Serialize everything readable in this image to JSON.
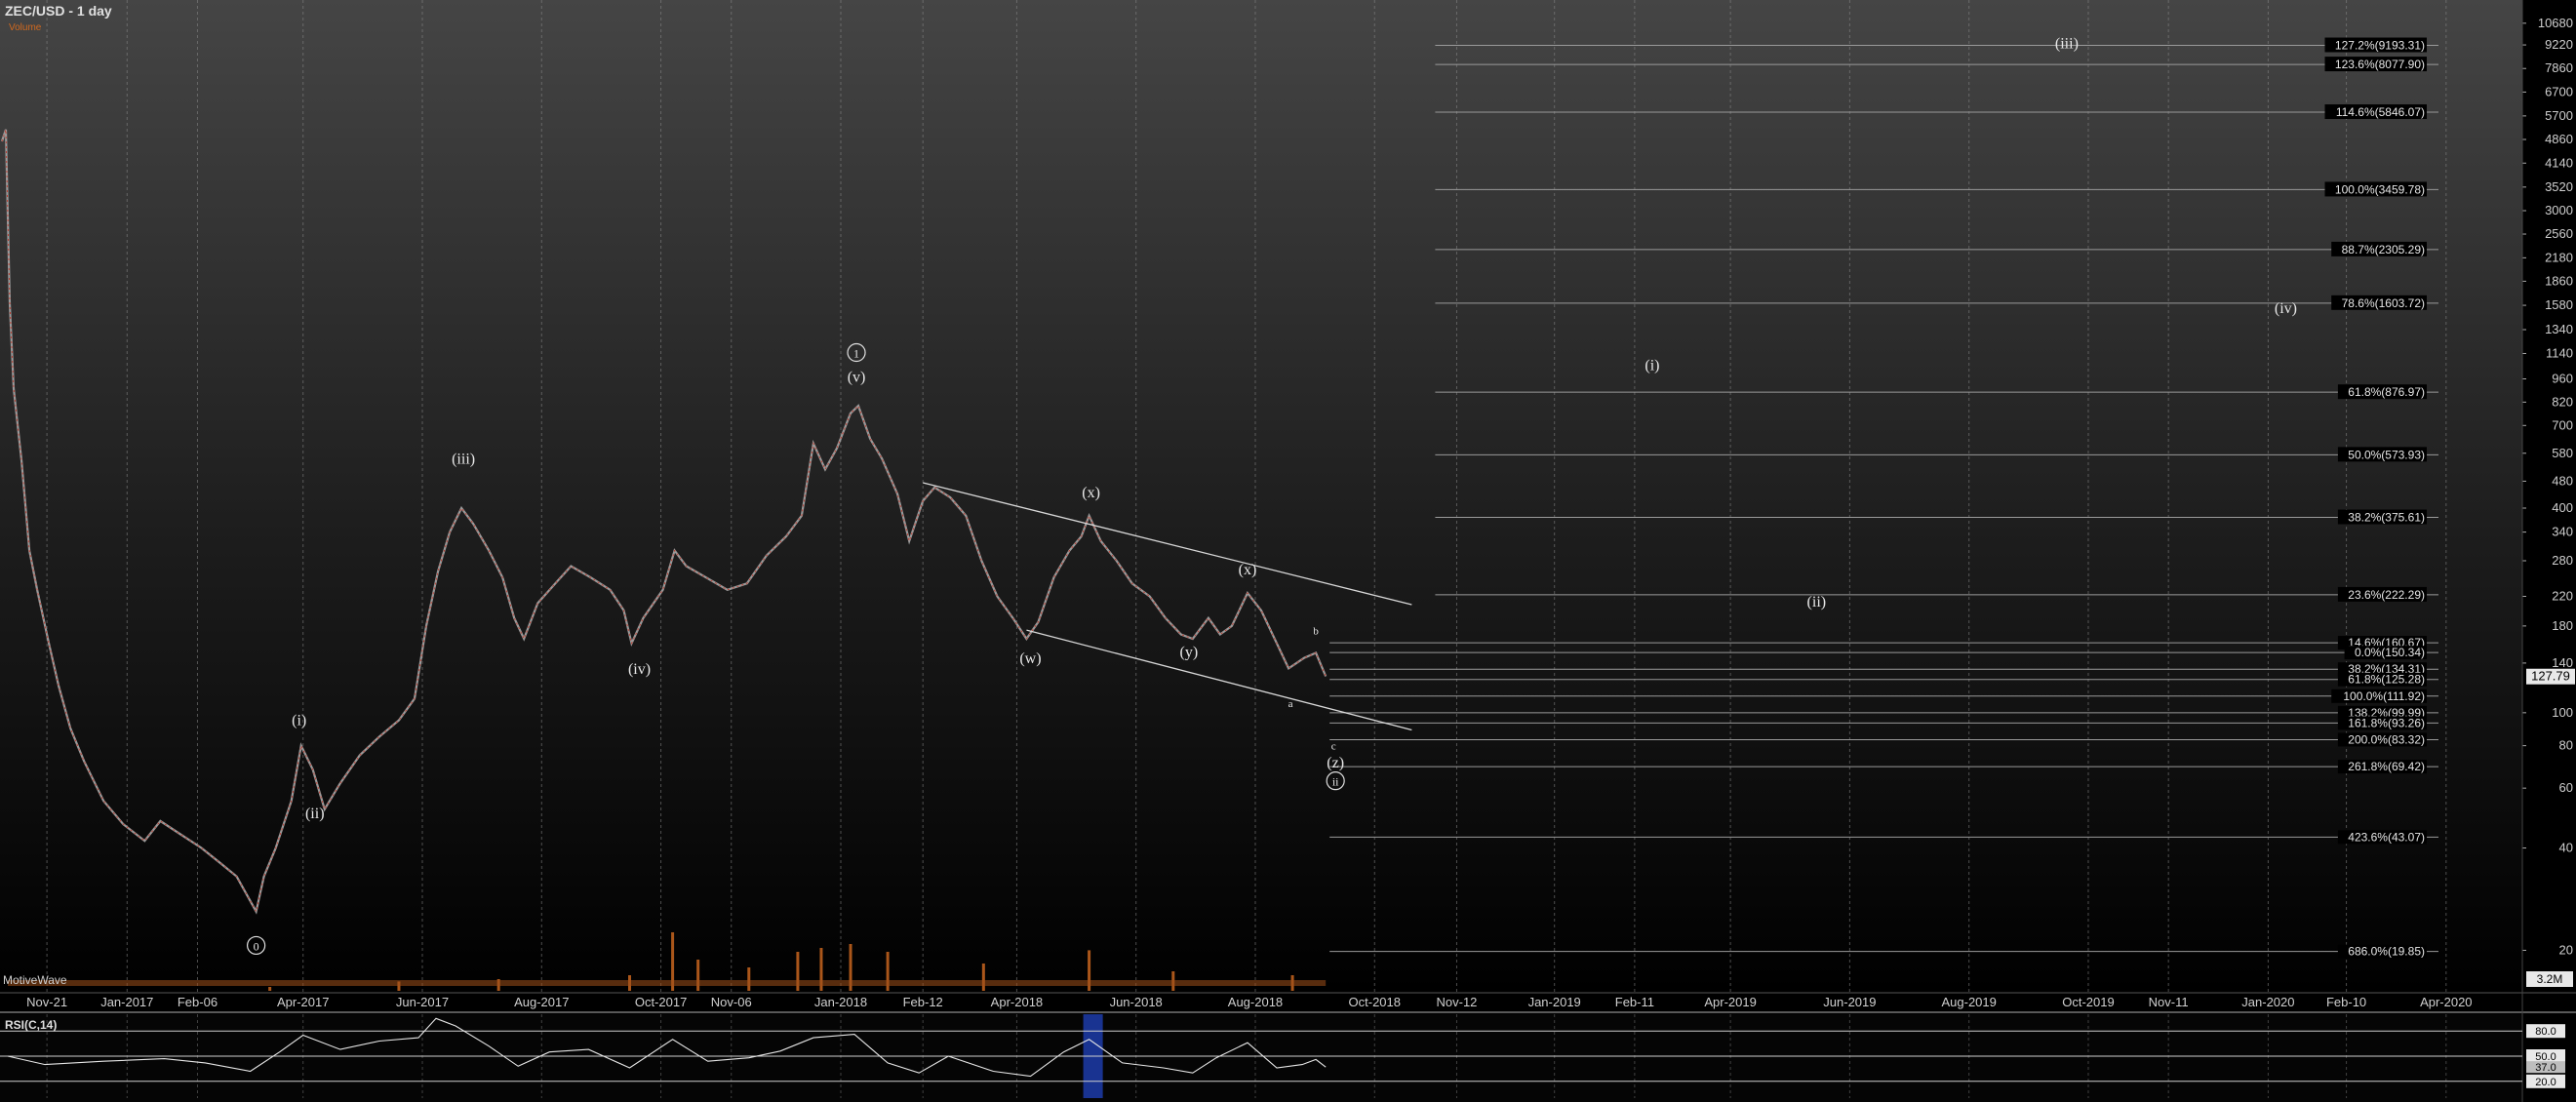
{
  "chart_data": {
    "type": "line",
    "title": "ZEC/USD - 1 day",
    "volume_label": "Volume",
    "motive_label": "MotiveWave",
    "price_axis": {
      "scale": "log",
      "range": [
        15,
        12500
      ],
      "ticks": [
        10680,
        9220,
        7860,
        6700,
        5700,
        4860,
        4140,
        3520,
        3000,
        2560,
        2180,
        1860,
        1580,
        1340,
        1140,
        960,
        820,
        700,
        580,
        480,
        400,
        340,
        280,
        220,
        180,
        140,
        100,
        80,
        60,
        40,
        20
      ]
    },
    "date_axis": {
      "range": [
        "2016-10-28",
        "2020-05-10"
      ],
      "ticks": [
        {
          "date": "2016-11-21",
          "label": "Nov-21"
        },
        {
          "date": "2017-01-01",
          "label": "Jan-2017"
        },
        {
          "date": "2017-02-06",
          "label": "Feb-06"
        },
        {
          "date": "2017-04-01",
          "label": "Apr-2017"
        },
        {
          "date": "2017-06-01",
          "label": "Jun-2017"
        },
        {
          "date": "2017-08-01",
          "label": "Aug-2017"
        },
        {
          "date": "2017-10-01",
          "label": "Oct-2017"
        },
        {
          "date": "2017-11-06",
          "label": "Nov-06"
        },
        {
          "date": "2018-01-01",
          "label": "Jan-2018"
        },
        {
          "date": "2018-02-12",
          "label": "Feb-12"
        },
        {
          "date": "2018-04-01",
          "label": "Apr-2018"
        },
        {
          "date": "2018-06-01",
          "label": "Jun-2018"
        },
        {
          "date": "2018-08-01",
          "label": "Aug-2018"
        },
        {
          "date": "2018-10-01",
          "label": "Oct-2018"
        },
        {
          "date": "2018-11-12",
          "label": "Nov-12"
        },
        {
          "date": "2019-01-01",
          "label": "Jan-2019"
        },
        {
          "date": "2019-02-11",
          "label": "Feb-11"
        },
        {
          "date": "2019-04-01",
          "label": "Apr-2019"
        },
        {
          "date": "2019-06-01",
          "label": "Jun-2019"
        },
        {
          "date": "2019-08-01",
          "label": "Aug-2019"
        },
        {
          "date": "2019-10-01",
          "label": "Oct-2019"
        },
        {
          "date": "2019-11-11",
          "label": "Nov-11"
        },
        {
          "date": "2020-01-01",
          "label": "Jan-2020"
        },
        {
          "date": "2020-02-10",
          "label": "Feb-10"
        },
        {
          "date": "2020-04-01",
          "label": "Apr-2020"
        }
      ]
    },
    "price_series": [
      [
        "2016-10-29",
        4800
      ],
      [
        "2016-10-31",
        5200
      ],
      [
        "2016-11-02",
        1600
      ],
      [
        "2016-11-04",
        900
      ],
      [
        "2016-11-08",
        550
      ],
      [
        "2016-11-12",
        300
      ],
      [
        "2016-11-16",
        230
      ],
      [
        "2016-11-22",
        160
      ],
      [
        "2016-11-27",
        120
      ],
      [
        "2016-12-03",
        90
      ],
      [
        "2016-12-10",
        72
      ],
      [
        "2016-12-20",
        55
      ],
      [
        "2016-12-30",
        47
      ],
      [
        "2017-01-10",
        42
      ],
      [
        "2017-01-18",
        48
      ],
      [
        "2017-01-28",
        44
      ],
      [
        "2017-02-08",
        40
      ],
      [
        "2017-02-18",
        36
      ],
      [
        "2017-02-26",
        33
      ],
      [
        "2017-03-02",
        30
      ],
      [
        "2017-03-08",
        26
      ],
      [
        "2017-03-12",
        33
      ],
      [
        "2017-03-18",
        40
      ],
      [
        "2017-03-26",
        55
      ],
      [
        "2017-03-31",
        80
      ],
      [
        "2017-04-06",
        68
      ],
      [
        "2017-04-12",
        52
      ],
      [
        "2017-04-20",
        62
      ],
      [
        "2017-04-30",
        75
      ],
      [
        "2017-05-10",
        85
      ],
      [
        "2017-05-20",
        95
      ],
      [
        "2017-05-28",
        110
      ],
      [
        "2017-06-03",
        180
      ],
      [
        "2017-06-09",
        260
      ],
      [
        "2017-06-15",
        340
      ],
      [
        "2017-06-21",
        400
      ],
      [
        "2017-06-27",
        360
      ],
      [
        "2017-07-05",
        300
      ],
      [
        "2017-07-12",
        250
      ],
      [
        "2017-07-18",
        190
      ],
      [
        "2017-07-23",
        165
      ],
      [
        "2017-07-30",
        210
      ],
      [
        "2017-08-08",
        240
      ],
      [
        "2017-08-16",
        270
      ],
      [
        "2017-08-26",
        250
      ],
      [
        "2017-09-05",
        230
      ],
      [
        "2017-09-12",
        200
      ],
      [
        "2017-09-16",
        160
      ],
      [
        "2017-09-22",
        190
      ],
      [
        "2017-10-02",
        230
      ],
      [
        "2017-10-08",
        300
      ],
      [
        "2017-10-14",
        270
      ],
      [
        "2017-10-24",
        250
      ],
      [
        "2017-11-04",
        230
      ],
      [
        "2017-11-14",
        240
      ],
      [
        "2017-11-24",
        290
      ],
      [
        "2017-12-04",
        330
      ],
      [
        "2017-12-12",
        380
      ],
      [
        "2017-12-18",
        620
      ],
      [
        "2017-12-24",
        520
      ],
      [
        "2017-12-30",
        600
      ],
      [
        "2018-01-06",
        760
      ],
      [
        "2018-01-10",
        800
      ],
      [
        "2018-01-16",
        640
      ],
      [
        "2018-01-22",
        560
      ],
      [
        "2018-01-30",
        440
      ],
      [
        "2018-02-05",
        320
      ],
      [
        "2018-02-12",
        420
      ],
      [
        "2018-02-18",
        460
      ],
      [
        "2018-02-26",
        430
      ],
      [
        "2018-03-06",
        380
      ],
      [
        "2018-03-14",
        280
      ],
      [
        "2018-03-22",
        220
      ],
      [
        "2018-03-30",
        190
      ],
      [
        "2018-04-06",
        165
      ],
      [
        "2018-04-12",
        185
      ],
      [
        "2018-04-20",
        250
      ],
      [
        "2018-04-28",
        300
      ],
      [
        "2018-05-04",
        330
      ],
      [
        "2018-05-08",
        380
      ],
      [
        "2018-05-14",
        320
      ],
      [
        "2018-05-22",
        280
      ],
      [
        "2018-05-30",
        240
      ],
      [
        "2018-06-08",
        220
      ],
      [
        "2018-06-16",
        190
      ],
      [
        "2018-06-24",
        170
      ],
      [
        "2018-06-30",
        165
      ],
      [
        "2018-07-08",
        190
      ],
      [
        "2018-07-14",
        170
      ],
      [
        "2018-07-20",
        180
      ],
      [
        "2018-07-28",
        225
      ],
      [
        "2018-08-04",
        200
      ],
      [
        "2018-08-12",
        160
      ],
      [
        "2018-08-18",
        135
      ],
      [
        "2018-08-26",
        145
      ],
      [
        "2018-09-01",
        150
      ],
      [
        "2018-09-06",
        128
      ]
    ],
    "volume_series": [
      [
        "2017-03-15",
        0.05
      ],
      [
        "2017-05-20",
        0.12
      ],
      [
        "2017-07-10",
        0.15
      ],
      [
        "2017-09-15",
        0.2
      ],
      [
        "2017-10-07",
        0.75
      ],
      [
        "2017-10-20",
        0.4
      ],
      [
        "2017-11-15",
        0.3
      ],
      [
        "2017-12-10",
        0.5
      ],
      [
        "2017-12-22",
        0.55
      ],
      [
        "2018-01-06",
        0.6
      ],
      [
        "2018-01-25",
        0.5
      ],
      [
        "2018-03-15",
        0.35
      ],
      [
        "2018-05-08",
        0.52
      ],
      [
        "2018-06-20",
        0.25
      ],
      [
        "2018-08-20",
        0.2
      ]
    ],
    "channel_lines": [
      {
        "from": [
          "2018-02-12",
          475
        ],
        "to": [
          "2018-10-20",
          208
        ]
      },
      {
        "from": [
          "2018-04-06",
          175
        ],
        "to": [
          "2018-10-20",
          89
        ]
      }
    ],
    "fib_levels_upper": [
      {
        "value": 9193.31,
        "label": "127.2%(9193.31)"
      },
      {
        "value": 8077.9,
        "label": "123.6%(8077.90)"
      },
      {
        "value": 5846.07,
        "label": "114.6%(5846.07)"
      },
      {
        "value": 3459.78,
        "label": "100.0%(3459.78)"
      },
      {
        "value": 2305.29,
        "label": "88.7%(2305.29)"
      },
      {
        "value": 1603.72,
        "label": "78.6%(1603.72)"
      },
      {
        "value": 876.97,
        "label": "61.8%(876.97)"
      },
      {
        "value": 573.93,
        "label": "50.0%(573.93)"
      },
      {
        "value": 375.61,
        "label": "38.2%(375.61)"
      },
      {
        "value": 222.29,
        "label": "23.6%(222.29)"
      }
    ],
    "fib_levels_lower": [
      {
        "value": 160.67,
        "label": "14.6%(160.67)"
      },
      {
        "value": 150.34,
        "label": "0.0%(150.34)"
      },
      {
        "value": 134.31,
        "label": "38.2%(134.31)"
      },
      {
        "value": 125.28,
        "label": "61.8%(125.28)"
      },
      {
        "value": 111.92,
        "label": "100.0%(111.92)"
      },
      {
        "value": 99.99,
        "label": "138.2%(99.99)"
      },
      {
        "value": 93.26,
        "label": "161.8%(93.26)"
      },
      {
        "value": 83.32,
        "label": "200.0%(83.32)"
      },
      {
        "value": 69.42,
        "label": "261.8%(69.42)"
      },
      {
        "value": 43.07,
        "label": "423.6%(43.07)"
      },
      {
        "value": 19.85,
        "label": "686.0%(19.85)"
      }
    ],
    "last_price": {
      "value": 127.79,
      "label": "127.79"
    },
    "volume_last": {
      "label": "3.2M"
    },
    "wave_labels": [
      {
        "text": "1",
        "circled": true,
        "date": "2018-01-09",
        "price": 1110
      },
      {
        "text": "(v)",
        "date": "2018-01-09",
        "price": 940
      },
      {
        "text": "(iii)",
        "date": "2017-06-22",
        "price": 540
      },
      {
        "text": "(iv)",
        "date": "2017-09-20",
        "price": 130
      },
      {
        "text": "(i)",
        "date": "2017-03-30",
        "price": 92
      },
      {
        "text": "(ii)",
        "date": "2017-04-07",
        "price": 49
      },
      {
        "text": "0",
        "circled": true,
        "date": "2017-03-08",
        "price": 20
      },
      {
        "text": "(x)",
        "date": "2018-05-09",
        "price": 430
      },
      {
        "text": "(w)",
        "date": "2018-04-08",
        "price": 140
      },
      {
        "text": "(y)",
        "date": "2018-06-28",
        "price": 146
      },
      {
        "text": "(x)",
        "date": "2018-07-28",
        "price": 255
      },
      {
        "text": "b",
        "date": "2018-09-01",
        "price": 170,
        "small": true
      },
      {
        "text": "a",
        "date": "2018-08-19",
        "price": 104,
        "small": true
      },
      {
        "text": "c",
        "date": "2018-09-10",
        "price": 78,
        "small": true
      },
      {
        "text": "(z)",
        "date": "2018-09-11",
        "price": 69
      },
      {
        "text": "ii",
        "circled": true,
        "date": "2018-09-11",
        "price": 61
      },
      {
        "text": "(i)",
        "date": "2019-02-20",
        "price": 1020
      },
      {
        "text": "(ii)",
        "date": "2019-05-15",
        "price": 205
      },
      {
        "text": "(iii)",
        "date": "2019-09-20",
        "price": 9000
      },
      {
        "text": "(iv)",
        "date": "2020-01-10",
        "price": 1500
      }
    ],
    "rsi": {
      "title": "RSI(C,14)",
      "range": [
        0,
        100
      ],
      "levels": [
        {
          "value": 80,
          "label": "80.0"
        },
        {
          "value": 50,
          "label": "50.0"
        },
        {
          "value": 20,
          "label": "20.0"
        }
      ],
      "last": {
        "value": 37,
        "label": "37.0"
      },
      "highlight": {
        "from": "2018-05-05",
        "to": "2018-05-15"
      },
      "series": [
        [
          "2016-11-01",
          50
        ],
        [
          "2016-11-20",
          40
        ],
        [
          "2016-12-20",
          44
        ],
        [
          "2017-01-20",
          47
        ],
        [
          "2017-02-10",
          42
        ],
        [
          "2017-03-05",
          32
        ],
        [
          "2017-03-20",
          55
        ],
        [
          "2017-04-01",
          75
        ],
        [
          "2017-04-20",
          58
        ],
        [
          "2017-05-10",
          68
        ],
        [
          "2017-05-30",
          72
        ],
        [
          "2017-06-08",
          95
        ],
        [
          "2017-06-18",
          86
        ],
        [
          "2017-07-05",
          62
        ],
        [
          "2017-07-20",
          38
        ],
        [
          "2017-08-05",
          55
        ],
        [
          "2017-08-25",
          58
        ],
        [
          "2017-09-15",
          36
        ],
        [
          "2017-10-07",
          70
        ],
        [
          "2017-10-25",
          44
        ],
        [
          "2017-11-15",
          48
        ],
        [
          "2017-12-01",
          56
        ],
        [
          "2017-12-18",
          72
        ],
        [
          "2018-01-08",
          76
        ],
        [
          "2018-01-25",
          42
        ],
        [
          "2018-02-10",
          30
        ],
        [
          "2018-02-25",
          50
        ],
        [
          "2018-03-20",
          32
        ],
        [
          "2018-04-08",
          26
        ],
        [
          "2018-04-25",
          55
        ],
        [
          "2018-05-08",
          70
        ],
        [
          "2018-05-25",
          42
        ],
        [
          "2018-06-15",
          36
        ],
        [
          "2018-06-30",
          30
        ],
        [
          "2018-07-12",
          48
        ],
        [
          "2018-07-28",
          66
        ],
        [
          "2018-08-12",
          36
        ],
        [
          "2018-08-25",
          40
        ],
        [
          "2018-09-01",
          46
        ],
        [
          "2018-09-06",
          37
        ]
      ]
    }
  }
}
